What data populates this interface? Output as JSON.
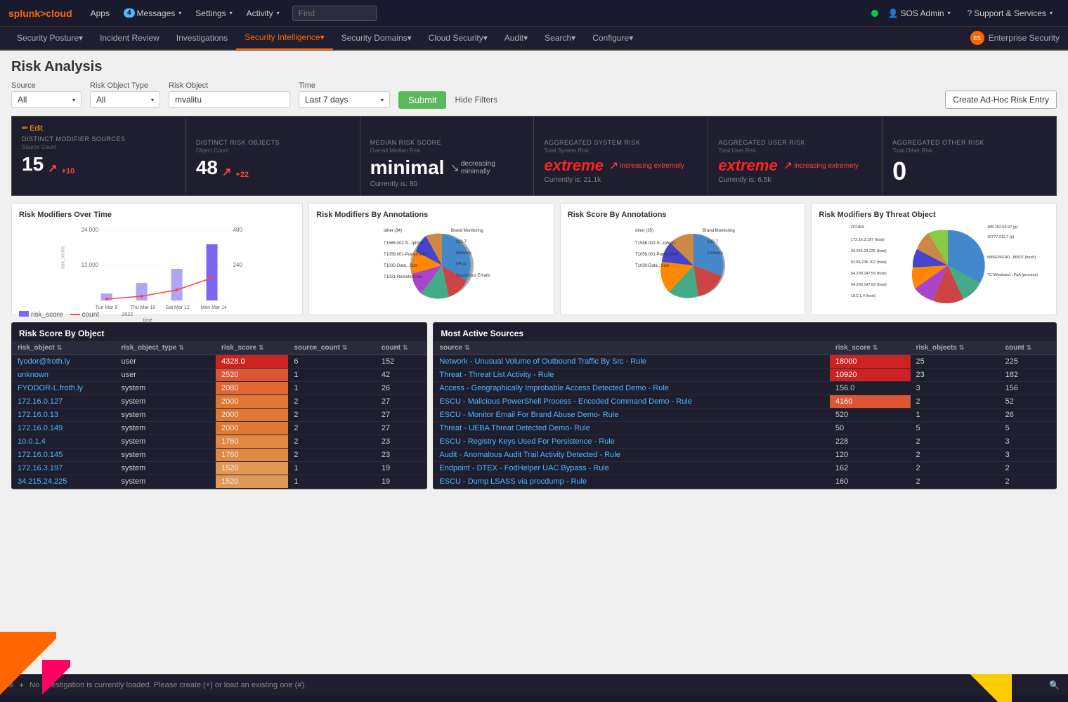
{
  "topNav": {
    "logo": "splunk>cloud",
    "items": [
      {
        "label": "Apps",
        "hasDropdown": true
      },
      {
        "label": "4 Messages",
        "hasBadge": true,
        "badge": "4",
        "hasDropdown": true
      },
      {
        "label": "Settings",
        "hasDropdown": true
      },
      {
        "label": "Activity",
        "hasDropdown": true
      }
    ],
    "search": {
      "placeholder": "Find"
    },
    "right": [
      {
        "label": "SOS Admin",
        "hasDropdown": true
      },
      {
        "label": "Support & Services",
        "hasDropdown": true
      }
    ]
  },
  "secondNav": {
    "items": [
      {
        "label": "Security Posture",
        "hasDropdown": true,
        "active": false
      },
      {
        "label": "Incident Review",
        "active": false
      },
      {
        "label": "Investigations",
        "active": false
      },
      {
        "label": "Security Intelligence",
        "hasDropdown": true,
        "active": true
      },
      {
        "label": "Security Domains",
        "hasDropdown": true,
        "active": false
      },
      {
        "label": "Cloud Security",
        "hasDropdown": true,
        "active": false
      },
      {
        "label": "Audit",
        "hasDropdown": true,
        "active": false
      },
      {
        "label": "Search",
        "hasDropdown": true,
        "active": false
      },
      {
        "label": "Configure",
        "hasDropdown": true,
        "active": false
      }
    ],
    "enterpriseSecurity": "Enterprise Security"
  },
  "page": {
    "title": "Risk Analysis"
  },
  "filters": {
    "source": {
      "label": "Source",
      "value": "All"
    },
    "riskObjectType": {
      "label": "Risk Object Type",
      "value": "All"
    },
    "riskObject": {
      "label": "Risk Object",
      "value": "mvalitu"
    },
    "time": {
      "label": "Time",
      "value": "Last 7 days"
    },
    "submitLabel": "Submit",
    "hideFiltersLabel": "Hide Filters",
    "createLabel": "Create Ad-Hoc Risk Entry"
  },
  "statsRow": {
    "editLabel": "Edit",
    "cards": [
      {
        "title": "DISTINCT MODIFIER SOURCES",
        "subtitle": "Source Count",
        "value": "15",
        "change": "+10",
        "changeDir": "up"
      },
      {
        "title": "DISTINCT RISK OBJECTS",
        "subtitle": "Object Count",
        "value": "48",
        "change": "+22",
        "changeDir": "up"
      },
      {
        "title": "MEDIAN RISK SCORE",
        "subtitle": "Overall Median Risk",
        "valueText": "minimal",
        "trendLabel": "decreasing minimally",
        "currently": "Currently is: 80"
      },
      {
        "title": "AGGREGATED SYSTEM RISK",
        "subtitle": "Total System Risk",
        "valueText": "extreme",
        "trendLabel": "increasing extremely",
        "currently": "Currently is: 21.1k"
      },
      {
        "title": "AGGREGATED USER RISK",
        "subtitle": "Total User Risk",
        "valueText": "extreme",
        "trendLabel": "increasing extremely",
        "currently": "Currently is: 6.5k"
      },
      {
        "title": "AGGREGATED OTHER RISK",
        "subtitle": "Total Other Risk",
        "value": "0"
      }
    ]
  },
  "charts": {
    "riskOverTime": {
      "title": "Risk Modifiers Over Time",
      "yLabel": "risk_score",
      "xLabels": [
        "Tue Mar 8",
        "Thu Mar 10",
        "Sat Mar 12",
        "Mon Mar 14"
      ],
      "yValues": [
        "24,000",
        "12,000"
      ],
      "rightY": [
        "480",
        "240"
      ],
      "legend": [
        "risk_score",
        "count"
      ],
      "year": "2022",
      "timeLabel": "time"
    },
    "byAnnotations": {
      "title": "Risk Modifiers By Annotations",
      "segments": [
        {
          "label": "other (34)",
          "color": "#aaaaaa"
        },
        {
          "label": "T1566.002 - S...rphishing Link",
          "color": "#4488cc"
        },
        {
          "label": "T1059.001 - PowerShell",
          "color": "#cc4444"
        },
        {
          "label": "T1030 - Data ...fer Size Limits",
          "color": "#44aa88"
        },
        {
          "label": "T1021 - Remote Services",
          "color": "#aa44cc"
        },
        {
          "label": "Brand Monitoring",
          "color": "#ff8800"
        },
        {
          "label": "CIS 7",
          "color": "#4444cc"
        },
        {
          "label": "Delivery",
          "color": "#cc8844"
        },
        {
          "label": "PR.IP",
          "color": "#88cc44"
        },
        {
          "label": "Suspicious Emails",
          "color": "#cc4488"
        }
      ]
    },
    "scoreByAnnotations": {
      "title": "Risk Score By Annotations",
      "segments": [
        {
          "label": "other (35)",
          "color": "#aaaaaa"
        },
        {
          "label": "T1566.002 - S...rphishing Link",
          "color": "#4488cc"
        },
        {
          "label": "T1059.001 - PowerShell",
          "color": "#cc4444"
        },
        {
          "label": "T1030 - Data ...fer Size Limits",
          "color": "#44aa88"
        },
        {
          "label": "Brand Monitoring",
          "color": "#ff8800"
        },
        {
          "label": "CIS 7",
          "color": "#4444cc"
        },
        {
          "label": "Delivery",
          "color": "#cc8844"
        }
      ]
    },
    "byThreatObject": {
      "title": "Risk Modifiers By Threat Object",
      "segments": [
        {
          "label": "OTHER",
          "color": "#aaaaaa"
        },
        {
          "label": "172.16.3.197 (host)",
          "color": "#4488cc"
        },
        {
          "label": "34.215.24.225 (host)",
          "color": "#44aa88"
        },
        {
          "label": "52.84.235.102 (host)",
          "color": "#cc4444"
        },
        {
          "label": "54.230.147.59 (host)",
          "color": "#aa44cc"
        },
        {
          "label": "54.230.147.59 (host)",
          "color": "#ff8800"
        },
        {
          "label": "10.0.1.4 (host)",
          "color": "#4444cc"
        },
        {
          "label": "5866F56F4D...86507 (hash)",
          "color": "#cc8844"
        },
        {
          "label": "185.192.69.97 (p)",
          "color": "#88cc44"
        },
        {
          "label": "10777.211.7 (p)",
          "color": "#cc4488"
        },
        {
          "label": "*C:\\Windows\\...PgA (process)",
          "color": "#44cccc"
        }
      ]
    }
  },
  "riskScoreTable": {
    "title": "Risk Score By Object",
    "columns": [
      "risk_object",
      "risk_object_type",
      "risk_score",
      "source_count",
      "count"
    ],
    "rows": [
      {
        "risk_object": "fyodor@froth.ly",
        "type": "user",
        "risk_score": "4328.0",
        "source_count": "6",
        "count": "152",
        "heat": "high"
      },
      {
        "risk_object": "unknown",
        "type": "user",
        "risk_score": "2520",
        "source_count": "1",
        "count": "42",
        "heat": "med"
      },
      {
        "risk_object": "FYODOR-L.froth.ly",
        "type": "system",
        "risk_score": "2080",
        "source_count": "1",
        "count": "26",
        "heat": "med-low"
      },
      {
        "risk_object": "172.16.0.127",
        "type": "system",
        "risk_score": "2000",
        "source_count": "2",
        "count": "27",
        "heat": "low"
      },
      {
        "risk_object": "172.16.0.13",
        "type": "system",
        "risk_score": "2000",
        "source_count": "2",
        "count": "27",
        "heat": "low"
      },
      {
        "risk_object": "172.16.0.149",
        "type": "system",
        "risk_score": "2000",
        "source_count": "2",
        "count": "27",
        "heat": "low"
      },
      {
        "risk_object": "10.0.1.4",
        "type": "system",
        "risk_score": "1760",
        "source_count": "2",
        "count": "23",
        "heat": "lower"
      },
      {
        "risk_object": "172.16.0.145",
        "type": "system",
        "risk_score": "1760",
        "source_count": "2",
        "count": "23",
        "heat": "lower"
      },
      {
        "risk_object": "172.16.3.197",
        "type": "system",
        "risk_score": "1520",
        "source_count": "1",
        "count": "19",
        "heat": "lowest"
      },
      {
        "risk_object": "34.215.24.225",
        "type": "system",
        "risk_score": "1520",
        "source_count": "1",
        "count": "19",
        "heat": "lowest"
      }
    ]
  },
  "mostActiveTable": {
    "title": "Most Active Sources",
    "columns": [
      "source",
      "risk_score",
      "risk_objects",
      "count"
    ],
    "rows": [
      {
        "source": "Network - Unusual Volume of Outbound Traffic By Src - Rule",
        "risk_score": "18000",
        "risk_objects": "25",
        "count": "225",
        "heat": "extreme"
      },
      {
        "source": "Threat - Threat List Activity - Rule",
        "risk_score": "10920",
        "risk_objects": "23",
        "count": "182",
        "heat": "extreme"
      },
      {
        "source": "Access - Geographically Improbable Access Detected Demo - Rule",
        "risk_score": "156.0",
        "risk_objects": "3",
        "count": "156",
        "heat": "none"
      },
      {
        "source": "ESCU - Malicious PowerShell Process - Encoded Command Demo - Rule",
        "risk_score": "4160",
        "risk_objects": "2",
        "count": "52",
        "heat": "high"
      },
      {
        "source": "ESCU - Monitor Email For Brand Abuse Demo- Rule",
        "risk_score": "520",
        "risk_objects": "1",
        "count": "26",
        "heat": "none"
      },
      {
        "source": "Threat - UEBA Threat Detected Demo- Rule",
        "risk_score": "50",
        "risk_objects": "5",
        "count": "5",
        "heat": "none"
      },
      {
        "source": "ESCU - Registry Keys Used For Persistence - Rule",
        "risk_score": "228",
        "risk_objects": "2",
        "count": "3",
        "heat": "none"
      },
      {
        "source": "Audit - Anomalous Audit Trail Activity Detected - Rule",
        "risk_score": "120",
        "risk_objects": "2",
        "count": "3",
        "heat": "none"
      },
      {
        "source": "Endpoint - DTEX - FodHelper UAC Bypass - Rule",
        "risk_score": "162",
        "risk_objects": "2",
        "count": "2",
        "heat": "none"
      },
      {
        "source": "ESCU - Dump LSASS via procdump - Rule",
        "risk_score": "160",
        "risk_objects": "2",
        "count": "2",
        "heat": "none"
      }
    ]
  },
  "bottomBar": {
    "message": "No investigation is currently loaded. Please create (+) or load an existing one (#)."
  }
}
